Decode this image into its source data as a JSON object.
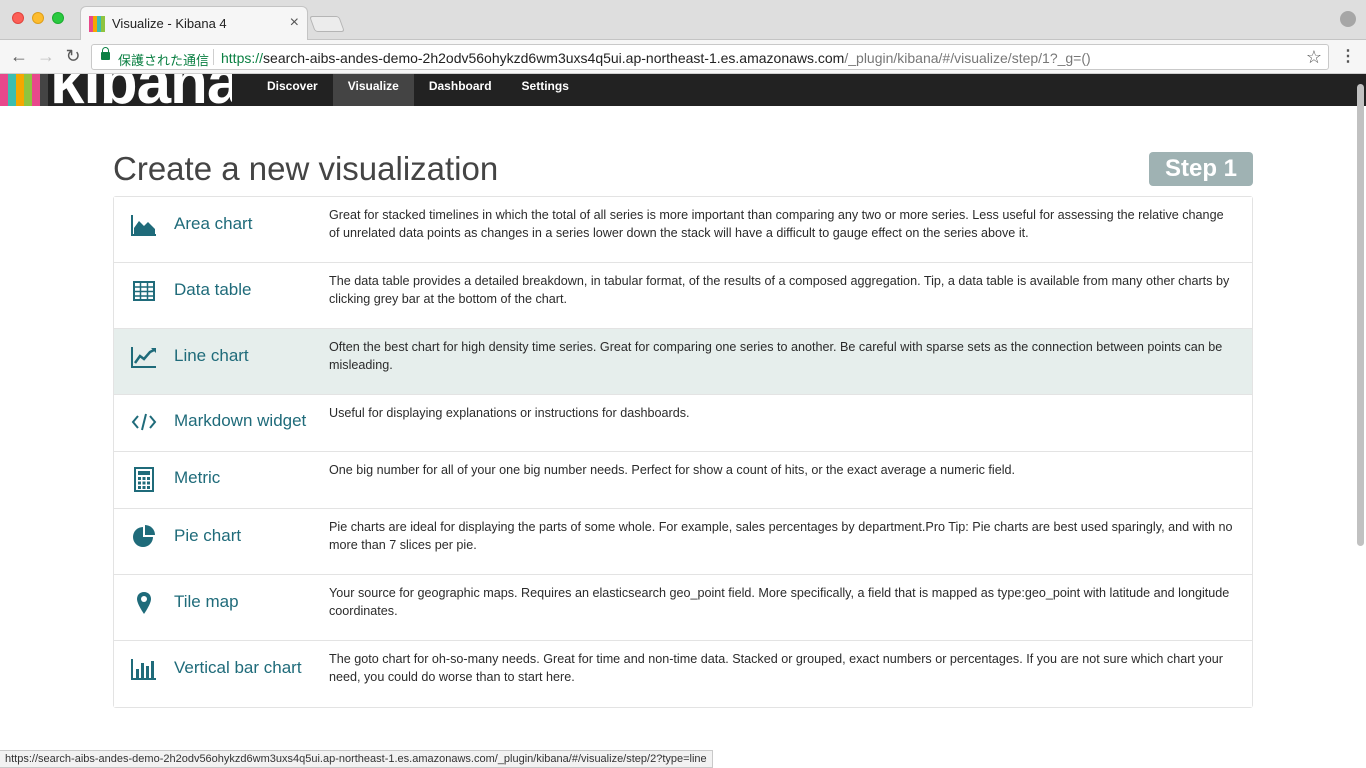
{
  "browser": {
    "tab_title": "Visualize - Kibana 4",
    "tab_close": "×",
    "back_glyph": "←",
    "forward_glyph": "→",
    "reload_glyph": "↻",
    "secure_label": "保護された通信",
    "url_scheme": "https://",
    "url_host": "search-aibs-andes-demo-2h2odv56ohykzd6wm3uxs4q5ui.ap-northeast-1.es.amazonaws.com",
    "url_path": "/_plugin/kibana/#/visualize/step/1?_g=()",
    "star_glyph": "☆",
    "menu_glyph": "⋮",
    "status_url": "https://search-aibs-andes-demo-2h2odv56ohykzd6wm3uxs4q5ui.ap-northeast-1.es.amazonaws.com/_plugin/kibana/#/visualize/step/2?type=line"
  },
  "kibana": {
    "logo_text": "kibana",
    "logo_colors": [
      "#e8488b",
      "#3cbeb0",
      "#f5a700",
      "#8fc43f",
      "#e8488b",
      "#444444"
    ],
    "nav": [
      {
        "label": "Discover",
        "active": false
      },
      {
        "label": "Visualize",
        "active": true
      },
      {
        "label": "Dashboard",
        "active": false
      },
      {
        "label": "Settings",
        "active": false
      }
    ]
  },
  "page": {
    "title": "Create a new visualization",
    "step_badge": "Step 1"
  },
  "vis_types": [
    {
      "icon": "area-chart-icon",
      "name": "Area chart",
      "description": "Great for stacked timelines in which the total of all series is more important than comparing any two or more series. Less useful for assessing the relative change of unrelated data points as changes in a series lower down the stack will have a difficult to gauge effect on the series above it."
    },
    {
      "icon": "table-icon",
      "name": "Data table",
      "description": "The data table provides a detailed breakdown, in tabular format, of the results of a composed aggregation. Tip, a data table is available from many other charts by clicking grey bar at the bottom of the chart."
    },
    {
      "icon": "line-chart-icon",
      "name": "Line chart",
      "description": "Often the best chart for high density time series. Great for comparing one series to another. Be careful with sparse sets as the connection between points can be misleading.",
      "selected": true
    },
    {
      "icon": "code-icon",
      "name": "Markdown widget",
      "description": "Useful for displaying explanations or instructions for dashboards."
    },
    {
      "icon": "calculator-icon",
      "name": "Metric",
      "description": "One big number for all of your one big number needs. Perfect for show a count of hits, or the exact average a numeric field."
    },
    {
      "icon": "pie-chart-icon",
      "name": "Pie chart",
      "description": "Pie charts are ideal for displaying the parts of some whole. For example, sales percentages by department.Pro Tip: Pie charts are best used sparingly, and with no more than 7 slices per pie."
    },
    {
      "icon": "map-marker-icon",
      "name": "Tile map",
      "description": "Your source for geographic maps. Requires an elasticsearch geo_point field. More specifically, a field that is mapped as type:geo_point with latitude and longitude coordinates."
    },
    {
      "icon": "bar-chart-icon",
      "name": "Vertical bar chart",
      "description": "The goto chart for oh-so-many needs. Great for time and non-time data. Stacked or grouped, exact numbers or percentages. If you are not sure which chart your need, you could do worse than to start here."
    }
  ],
  "colors": {
    "accent": "#1f6b7a",
    "nav_bg": "#222222",
    "nav_active": "#444444",
    "step_badge": "#9fb2b3",
    "selected_row": "#e6eeec"
  }
}
